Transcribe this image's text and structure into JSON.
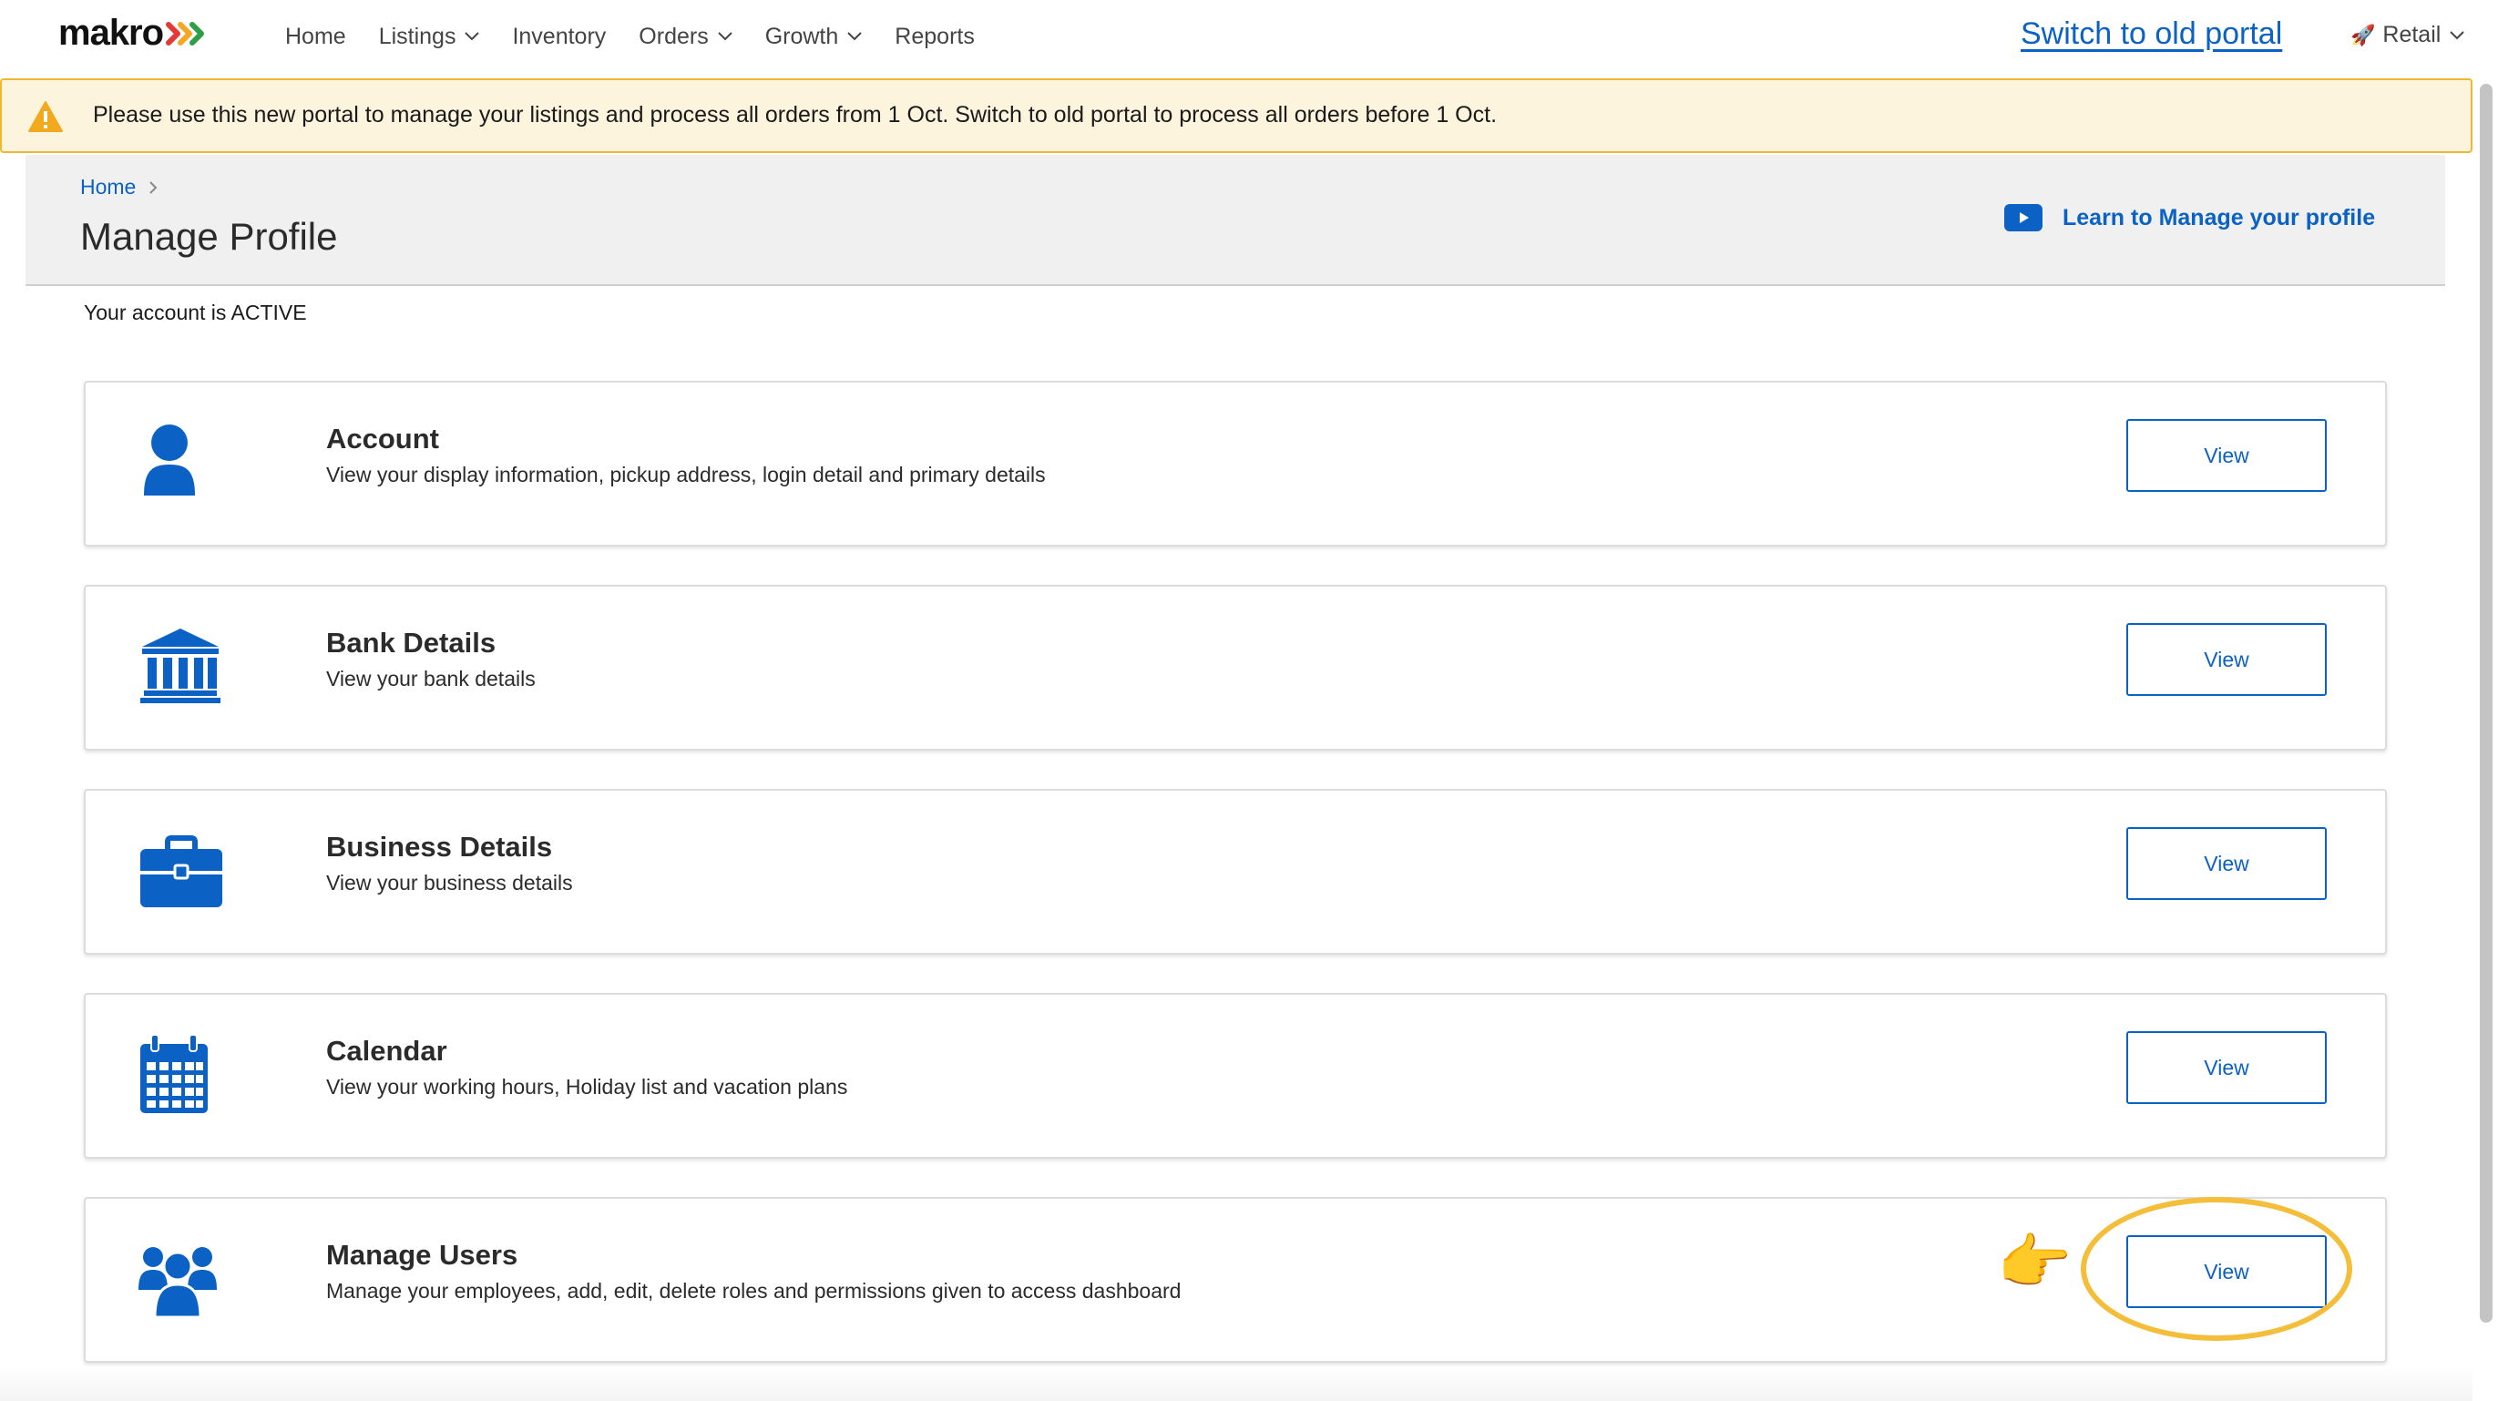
{
  "nav": {
    "logo": "makro",
    "items": [
      {
        "label": "Home",
        "dropdown": false
      },
      {
        "label": "Listings",
        "dropdown": true
      },
      {
        "label": "Inventory",
        "dropdown": false
      },
      {
        "label": "Orders",
        "dropdown": true
      },
      {
        "label": "Growth",
        "dropdown": true
      },
      {
        "label": "Reports",
        "dropdown": false
      }
    ],
    "switch_link": "Switch to old portal",
    "account_type": "Retail"
  },
  "banner": {
    "message": "Please use this new portal to manage your listings and process all orders from 1 Oct. Switch to old portal to process all orders before 1 Oct."
  },
  "header": {
    "breadcrumb": "Home",
    "title": "Manage Profile",
    "learn_link": "Learn to Manage your profile"
  },
  "status": "Your account is ACTIVE",
  "cards": [
    {
      "icon": "person-icon",
      "title": "Account",
      "desc": "View your display information, pickup address, login detail and primary details",
      "button": "View"
    },
    {
      "icon": "bank-icon",
      "title": "Bank Details",
      "desc": "View your bank details",
      "button": "View"
    },
    {
      "icon": "briefcase-icon",
      "title": "Business Details",
      "desc": "View your business details",
      "button": "View"
    },
    {
      "icon": "calendar-icon",
      "title": "Calendar",
      "desc": "View your working hours, Holiday list and vacation plans",
      "button": "View"
    },
    {
      "icon": "users-icon",
      "title": "Manage Users",
      "desc": "Manage your employees, add, edit, delete roles and permissions given to access dashboard",
      "button": "View"
    }
  ],
  "colors": {
    "primary": "#0b62c4",
    "banner_bg": "#fdf4dd",
    "banner_border": "#f2b731",
    "highlight": "#f4be3a"
  }
}
